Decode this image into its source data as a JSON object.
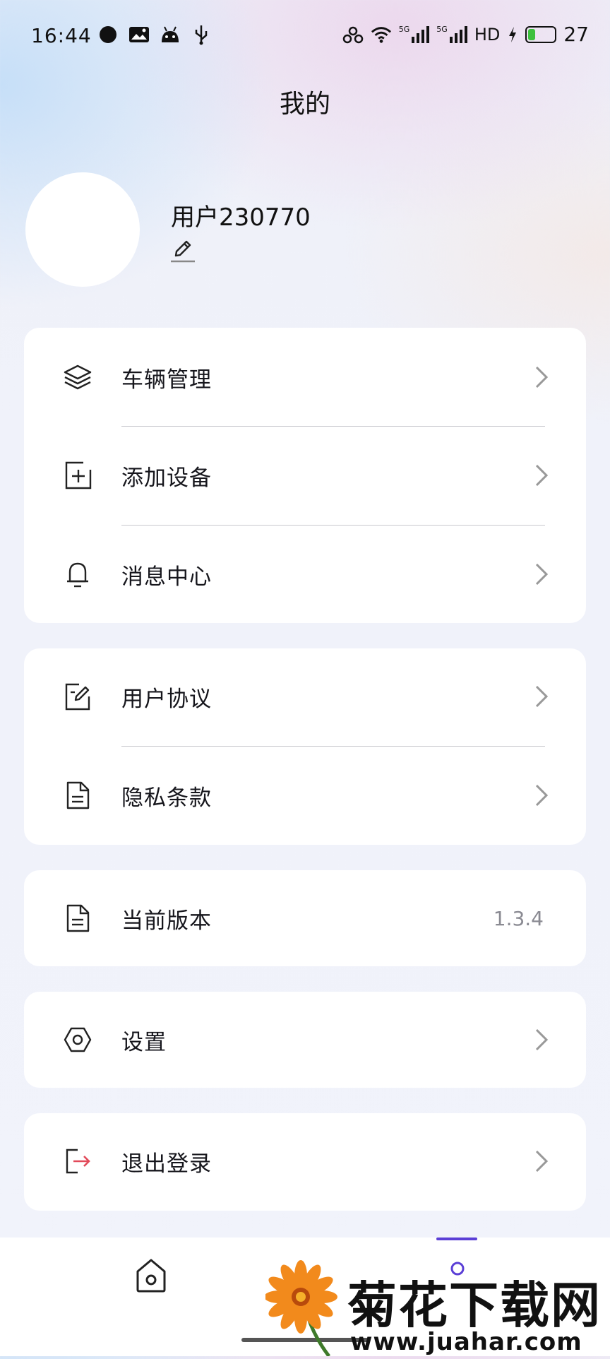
{
  "status_bar": {
    "time": "16:44",
    "network_5g_1": "5G",
    "network_5g_2": "5G",
    "hd_label": "HD",
    "battery_level": "27"
  },
  "header": {
    "title": "我的"
  },
  "profile": {
    "username": "用户230770"
  },
  "menu_groups": [
    {
      "items": [
        {
          "icon": "layers-icon",
          "label": "车辆管理"
        },
        {
          "icon": "add-square-icon",
          "label": "添加设备"
        },
        {
          "icon": "bell-icon",
          "label": "消息中心"
        }
      ]
    },
    {
      "items": [
        {
          "icon": "edit-document-icon",
          "label": "用户协议"
        },
        {
          "icon": "document-icon",
          "label": "隐私条款"
        }
      ]
    },
    {
      "items": [
        {
          "icon": "document-icon",
          "label": "当前版本",
          "value": "1.3.4"
        }
      ]
    },
    {
      "items": [
        {
          "icon": "hexagon-settings-icon",
          "label": "设置"
        }
      ]
    },
    {
      "items": [
        {
          "icon": "logout-icon",
          "label": "退出登录"
        }
      ]
    }
  ],
  "colors": {
    "accent": "#5b3fd6",
    "logout_arrow": "#e24a5a",
    "battery": "#3dc03d"
  },
  "watermark": {
    "title": "菊花下载网",
    "url": "www.juahar.com"
  }
}
